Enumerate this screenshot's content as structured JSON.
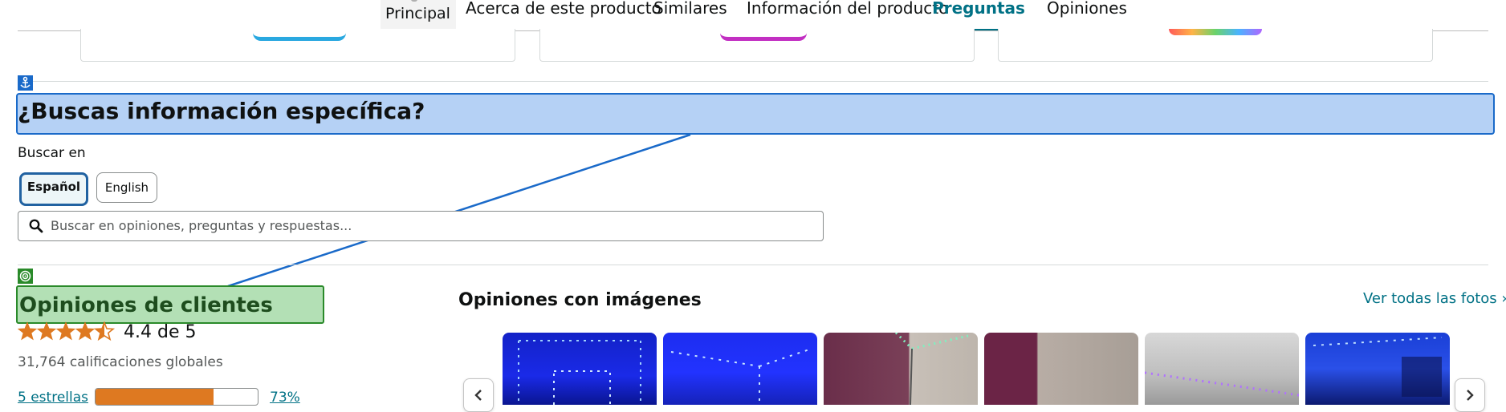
{
  "nav": {
    "tabs": [
      {
        "label": "Principal"
      },
      {
        "label": "Acerca de este producto"
      },
      {
        "label": "Similares"
      },
      {
        "label": "Información del producto"
      },
      {
        "label": "Preguntas",
        "active": true
      },
      {
        "label": "Opiniones"
      }
    ]
  },
  "search_section": {
    "heading": "¿Buscas información específica?",
    "search_in_label": "Buscar en",
    "languages": [
      {
        "label": "Español",
        "selected": true
      },
      {
        "label": "English",
        "selected": false
      }
    ],
    "search_placeholder": "Buscar en opiniones, preguntas y respuestas..."
  },
  "reviews": {
    "heading": "Opiniones de clientes",
    "rating": 4.4,
    "rating_text": "4.4 de 5",
    "global_ratings": "31,764 calificaciones globales",
    "star_rows": [
      {
        "label": "5 estrellas",
        "percent": "73%",
        "fraction": 0.73
      }
    ]
  },
  "images_section": {
    "heading": "Opiniones con imágenes",
    "see_all": "Ver todas las fotos ›"
  },
  "colors": {
    "link": "#007185",
    "active_tab": "#007185",
    "star": "#de7921",
    "annotation_blue": "#1a6ac9",
    "annotation_green": "#2a8a2a"
  },
  "icons": {
    "anchor": "anchor-icon",
    "target": "target-icon",
    "search": "search-icon",
    "carousel_prev": "chevron-left-icon",
    "carousel_next": "chevron-right-icon"
  }
}
